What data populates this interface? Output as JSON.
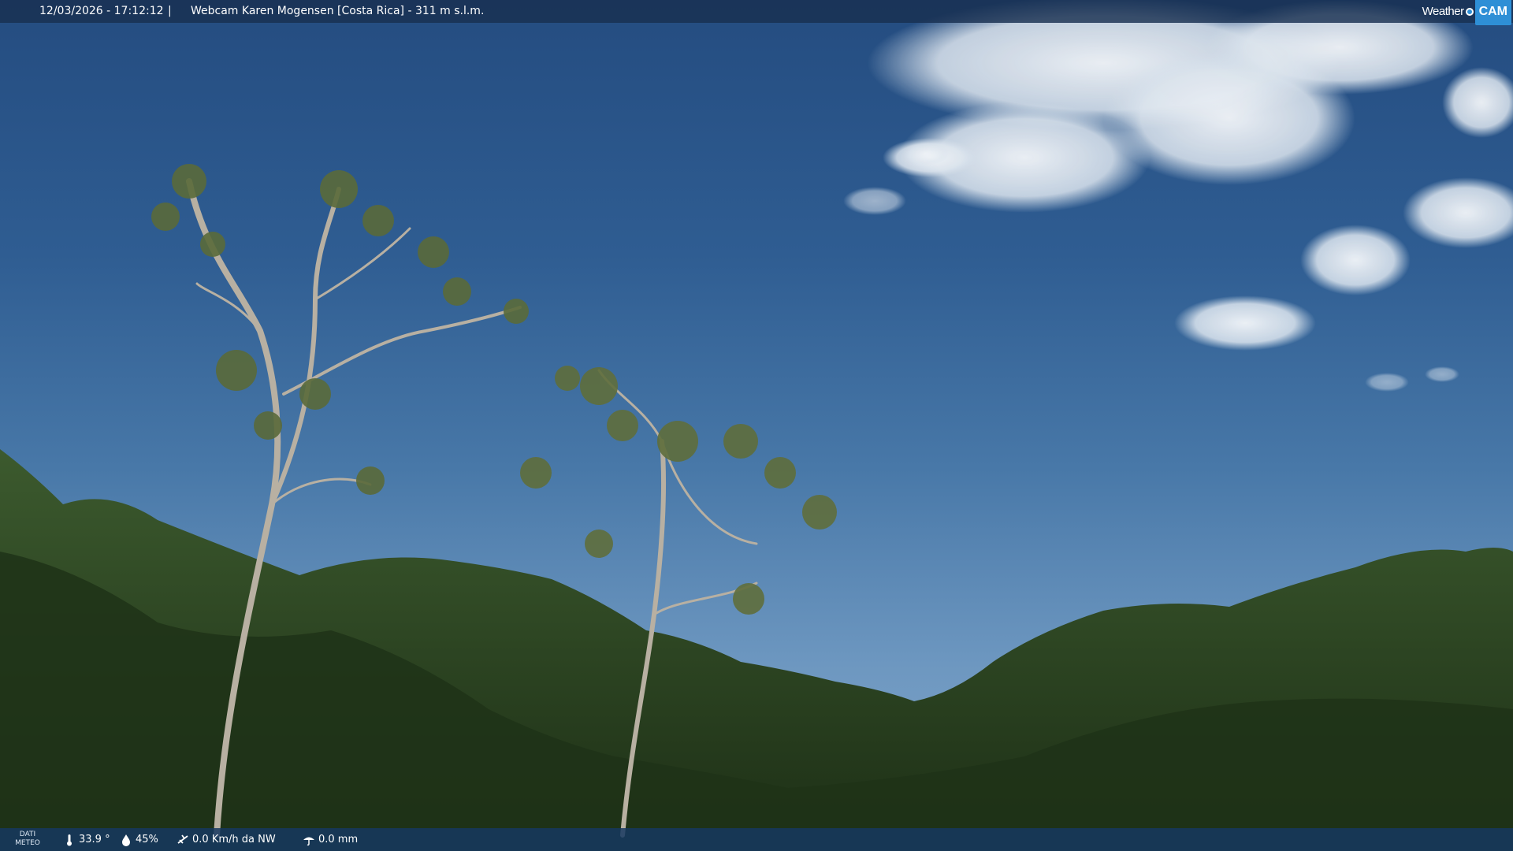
{
  "header": {
    "datetime": "12/03/2026 - 17:12:12",
    "separator": "|",
    "title": "Webcam Karen Mogensen [Costa Rica] - 311 m s.l.m.",
    "logo_weather": "Weather",
    "logo_cam": "CAM"
  },
  "footer": {
    "label_line1": "DATI",
    "label_line2": "METEO",
    "temperature": "33.9 °",
    "humidity": "45%",
    "wind": "0.0 Km/h da NW",
    "rain": "0.0 mm"
  },
  "icons": {
    "temperature": "thermometer-icon",
    "humidity": "humidity-drop-icon",
    "wind": "wind-icon",
    "rain": "rain-icon"
  },
  "colors": {
    "sky_top": "#244c80",
    "sky_bottom": "#86aacb",
    "bar_bg": "#183050",
    "logo_accent": "#2e8fd6"
  }
}
